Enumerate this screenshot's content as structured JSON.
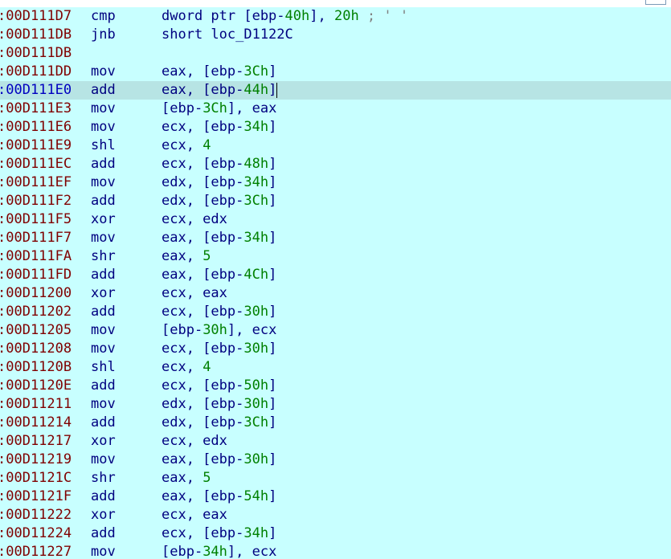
{
  "colors": {
    "background": "#c8ffff",
    "highlight_row": "#b7e4e4",
    "address": "#800000",
    "current_address": "#0000c0",
    "mnemonic": "#000080",
    "number": "#008000",
    "comment": "#808080"
  },
  "rows": [
    {
      "addr": ":00D111D7",
      "mnem": "cmp",
      "ops": [
        {
          "t": "dword ptr [ebp-"
        },
        {
          "t": "40h",
          "c": "num"
        },
        {
          "t": "], "
        },
        {
          "t": "20h",
          "c": "num"
        },
        {
          "t": " ; ' '",
          "c": "cmt"
        }
      ]
    },
    {
      "addr": ":00D111DB",
      "mnem": "jnb",
      "ops": [
        {
          "t": "short loc_D1122C"
        }
      ]
    },
    {
      "addr": ":00D111DB",
      "mnem": "",
      "ops": []
    },
    {
      "addr": ":00D111DD",
      "mnem": "mov",
      "ops": [
        {
          "t": "eax, [ebp-"
        },
        {
          "t": "3Ch",
          "c": "num"
        },
        {
          "t": "]"
        }
      ]
    },
    {
      "addr": ":00D111E0",
      "mnem": "add",
      "current": true,
      "ops": [
        {
          "t": "eax, [ebp-"
        },
        {
          "t": "44h",
          "c": "num"
        },
        {
          "t": "]"
        }
      ]
    },
    {
      "addr": ":00D111E3",
      "mnem": "mov",
      "ops": [
        {
          "t": "[ebp-"
        },
        {
          "t": "3Ch",
          "c": "num"
        },
        {
          "t": "], eax"
        }
      ]
    },
    {
      "addr": ":00D111E6",
      "mnem": "mov",
      "ops": [
        {
          "t": "ecx, [ebp-"
        },
        {
          "t": "34h",
          "c": "num"
        },
        {
          "t": "]"
        }
      ]
    },
    {
      "addr": ":00D111E9",
      "mnem": "shl",
      "ops": [
        {
          "t": "ecx, "
        },
        {
          "t": "4",
          "c": "num"
        }
      ]
    },
    {
      "addr": ":00D111EC",
      "mnem": "add",
      "ops": [
        {
          "t": "ecx, [ebp-"
        },
        {
          "t": "48h",
          "c": "num"
        },
        {
          "t": "]"
        }
      ]
    },
    {
      "addr": ":00D111EF",
      "mnem": "mov",
      "ops": [
        {
          "t": "edx, [ebp-"
        },
        {
          "t": "34h",
          "c": "num"
        },
        {
          "t": "]"
        }
      ]
    },
    {
      "addr": ":00D111F2",
      "mnem": "add",
      "ops": [
        {
          "t": "edx, [ebp-"
        },
        {
          "t": "3Ch",
          "c": "num"
        },
        {
          "t": "]"
        }
      ]
    },
    {
      "addr": ":00D111F5",
      "mnem": "xor",
      "ops": [
        {
          "t": "ecx, edx"
        }
      ]
    },
    {
      "addr": ":00D111F7",
      "mnem": "mov",
      "ops": [
        {
          "t": "eax, [ebp-"
        },
        {
          "t": "34h",
          "c": "num"
        },
        {
          "t": "]"
        }
      ]
    },
    {
      "addr": ":00D111FA",
      "mnem": "shr",
      "ops": [
        {
          "t": "eax, "
        },
        {
          "t": "5",
          "c": "num"
        }
      ]
    },
    {
      "addr": ":00D111FD",
      "mnem": "add",
      "ops": [
        {
          "t": "eax, [ebp-"
        },
        {
          "t": "4Ch",
          "c": "num"
        },
        {
          "t": "]"
        }
      ]
    },
    {
      "addr": ":00D11200",
      "mnem": "xor",
      "ops": [
        {
          "t": "ecx, eax"
        }
      ]
    },
    {
      "addr": ":00D11202",
      "mnem": "add",
      "ops": [
        {
          "t": "ecx, [ebp-"
        },
        {
          "t": "30h",
          "c": "num"
        },
        {
          "t": "]"
        }
      ]
    },
    {
      "addr": ":00D11205",
      "mnem": "mov",
      "ops": [
        {
          "t": "[ebp-"
        },
        {
          "t": "30h",
          "c": "num"
        },
        {
          "t": "], ecx"
        }
      ]
    },
    {
      "addr": ":00D11208",
      "mnem": "mov",
      "ops": [
        {
          "t": "ecx, [ebp-"
        },
        {
          "t": "30h",
          "c": "num"
        },
        {
          "t": "]"
        }
      ]
    },
    {
      "addr": ":00D1120B",
      "mnem": "shl",
      "ops": [
        {
          "t": "ecx, "
        },
        {
          "t": "4",
          "c": "num"
        }
      ]
    },
    {
      "addr": ":00D1120E",
      "mnem": "add",
      "ops": [
        {
          "t": "ecx, [ebp-"
        },
        {
          "t": "50h",
          "c": "num"
        },
        {
          "t": "]"
        }
      ]
    },
    {
      "addr": ":00D11211",
      "mnem": "mov",
      "ops": [
        {
          "t": "edx, [ebp-"
        },
        {
          "t": "30h",
          "c": "num"
        },
        {
          "t": "]"
        }
      ]
    },
    {
      "addr": ":00D11214",
      "mnem": "add",
      "ops": [
        {
          "t": "edx, [ebp-"
        },
        {
          "t": "3Ch",
          "c": "num"
        },
        {
          "t": "]"
        }
      ]
    },
    {
      "addr": ":00D11217",
      "mnem": "xor",
      "ops": [
        {
          "t": "ecx, edx"
        }
      ]
    },
    {
      "addr": ":00D11219",
      "mnem": "mov",
      "ops": [
        {
          "t": "eax, [ebp-"
        },
        {
          "t": "30h",
          "c": "num"
        },
        {
          "t": "]"
        }
      ]
    },
    {
      "addr": ":00D1121C",
      "mnem": "shr",
      "ops": [
        {
          "t": "eax, "
        },
        {
          "t": "5",
          "c": "num"
        }
      ]
    },
    {
      "addr": ":00D1121F",
      "mnem": "add",
      "ops": [
        {
          "t": "eax, [ebp-"
        },
        {
          "t": "54h",
          "c": "num"
        },
        {
          "t": "]"
        }
      ]
    },
    {
      "addr": ":00D11222",
      "mnem": "xor",
      "ops": [
        {
          "t": "ecx, eax"
        }
      ]
    },
    {
      "addr": ":00D11224",
      "mnem": "add",
      "ops": [
        {
          "t": "ecx, [ebp-"
        },
        {
          "t": "34h",
          "c": "num"
        },
        {
          "t": "]"
        }
      ]
    },
    {
      "addr": ":00D11227",
      "mnem": "mov",
      "ops": [
        {
          "t": "[ebp-"
        },
        {
          "t": "34h",
          "c": "num"
        },
        {
          "t": "], ecx"
        }
      ]
    }
  ]
}
